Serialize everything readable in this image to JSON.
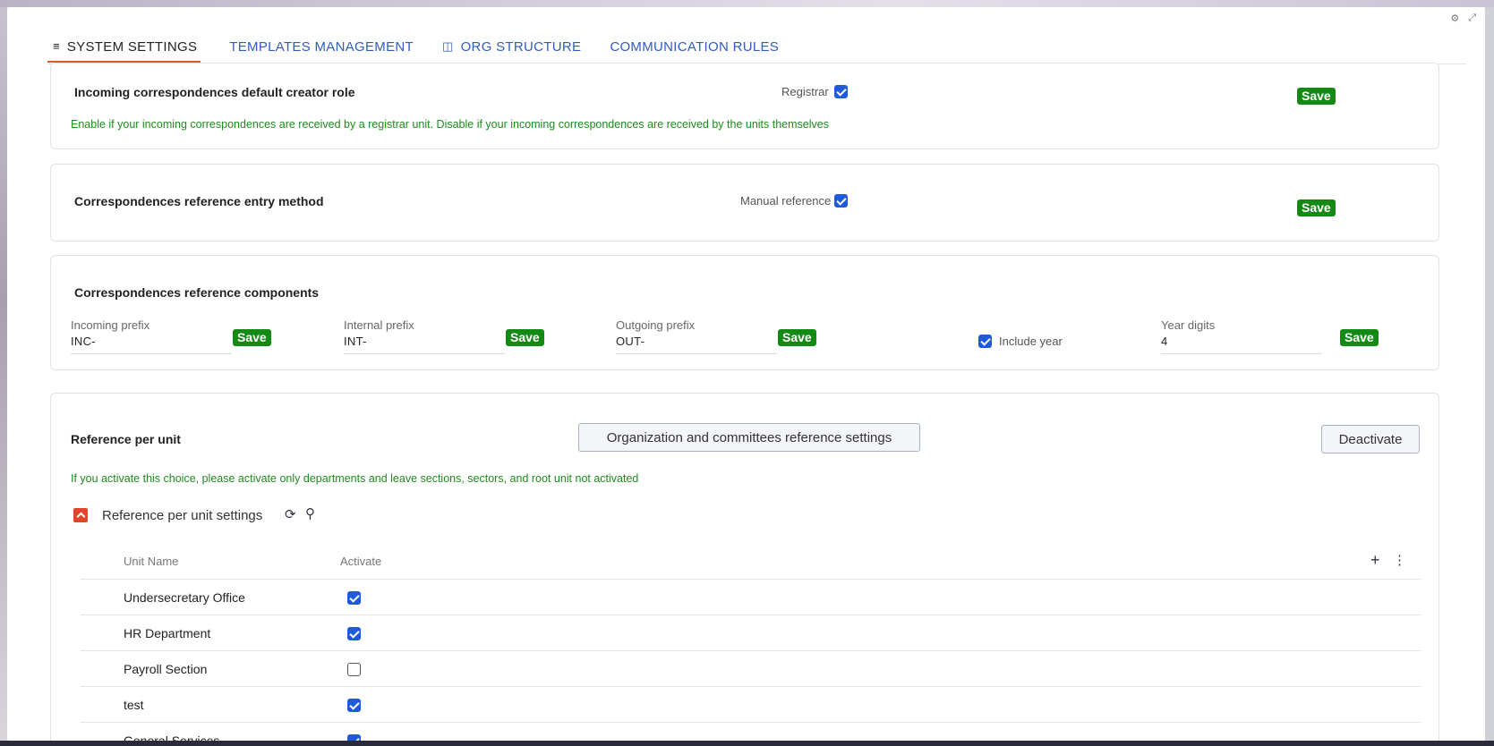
{
  "tabs": [
    {
      "label": "SYSTEM SETTINGS",
      "icon": "checklist-icon",
      "active": true
    },
    {
      "label": "TEMPLATES MANAGEMENT",
      "icon": "",
      "active": false
    },
    {
      "label": "ORG STRUCTURE",
      "icon": "org-tree-icon",
      "active": false
    },
    {
      "label": "COMMUNICATION RULES",
      "icon": "",
      "active": false
    }
  ],
  "creator_role": {
    "title": "Incoming correspondences default creator role",
    "checkbox_label": "Registrar",
    "checked": true,
    "help": "Enable if your incoming correspondences are received by a registrar unit. Disable if your incoming correspondences are received by the units themselves",
    "save_label": "Save"
  },
  "entry_method": {
    "title": "Correspondences reference entry method",
    "checkbox_label": "Manual reference",
    "checked": true,
    "save_label": "Save"
  },
  "components": {
    "title": "Correspondences reference components",
    "incoming_label": "Incoming prefix",
    "incoming_value": "INC-",
    "internal_label": "Internal prefix",
    "internal_value": "INT-",
    "outgoing_label": "Outgoing prefix",
    "outgoing_value": "OUT-",
    "include_year_label": "Include year",
    "include_year_checked": true,
    "year_digits_label": "Year digits",
    "year_digits_value": "4",
    "save_label": "Save"
  },
  "per_unit": {
    "title": "Reference per unit",
    "org_settings_button": "Organization and committees reference settings",
    "deactivate_button": "Deactivate",
    "help": "If you activate this choice, please activate only departments and leave sections, sectors, and root unit not activated",
    "settings_title": "Reference per unit settings",
    "col_unit": "Unit Name",
    "col_activate": "Activate",
    "rows": [
      {
        "name": "Undersecretary Office",
        "active": true
      },
      {
        "name": "HR Department",
        "active": true
      },
      {
        "name": "Payroll Section",
        "active": false
      },
      {
        "name": "test",
        "active": true
      },
      {
        "name": "General Services",
        "active": true
      }
    ]
  },
  "colors": {
    "accent_blue": "#2f5dbf",
    "save_green": "#138a13",
    "help_green": "#1f8a1f",
    "tab_underline": "#e4572e",
    "checkbox_blue": "#1f5bd8"
  }
}
